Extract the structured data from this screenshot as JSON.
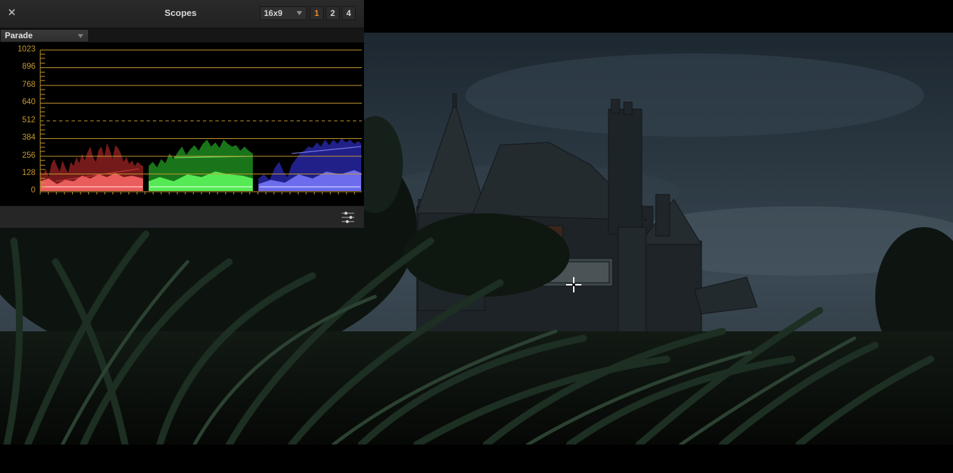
{
  "scopes_window": {
    "title": "Scopes",
    "close_label": "✕",
    "aspect_ratio": "16x9",
    "layout_buttons": [
      {
        "label": "1",
        "active": true
      },
      {
        "label": "2",
        "active": false
      },
      {
        "label": "4",
        "active": false
      }
    ],
    "mode": "Parade",
    "scale_labels": [
      "1023",
      "896",
      "768",
      "640",
      "512",
      "384",
      "256",
      "128",
      "0"
    ],
    "colors": {
      "accent": "#f08a1c",
      "graticule": "#c79a2e",
      "red_channel": "#ff5050",
      "green_channel": "#3cff3c",
      "blue_channel": "#5a5aff"
    }
  },
  "icons": {
    "close": "close-icon",
    "settings": "sliders-icon",
    "aspect_dropdown": "chevron-down-icon",
    "mode_dropdown": "chevron-down-icon",
    "cursor": "crosshair-icon"
  }
}
